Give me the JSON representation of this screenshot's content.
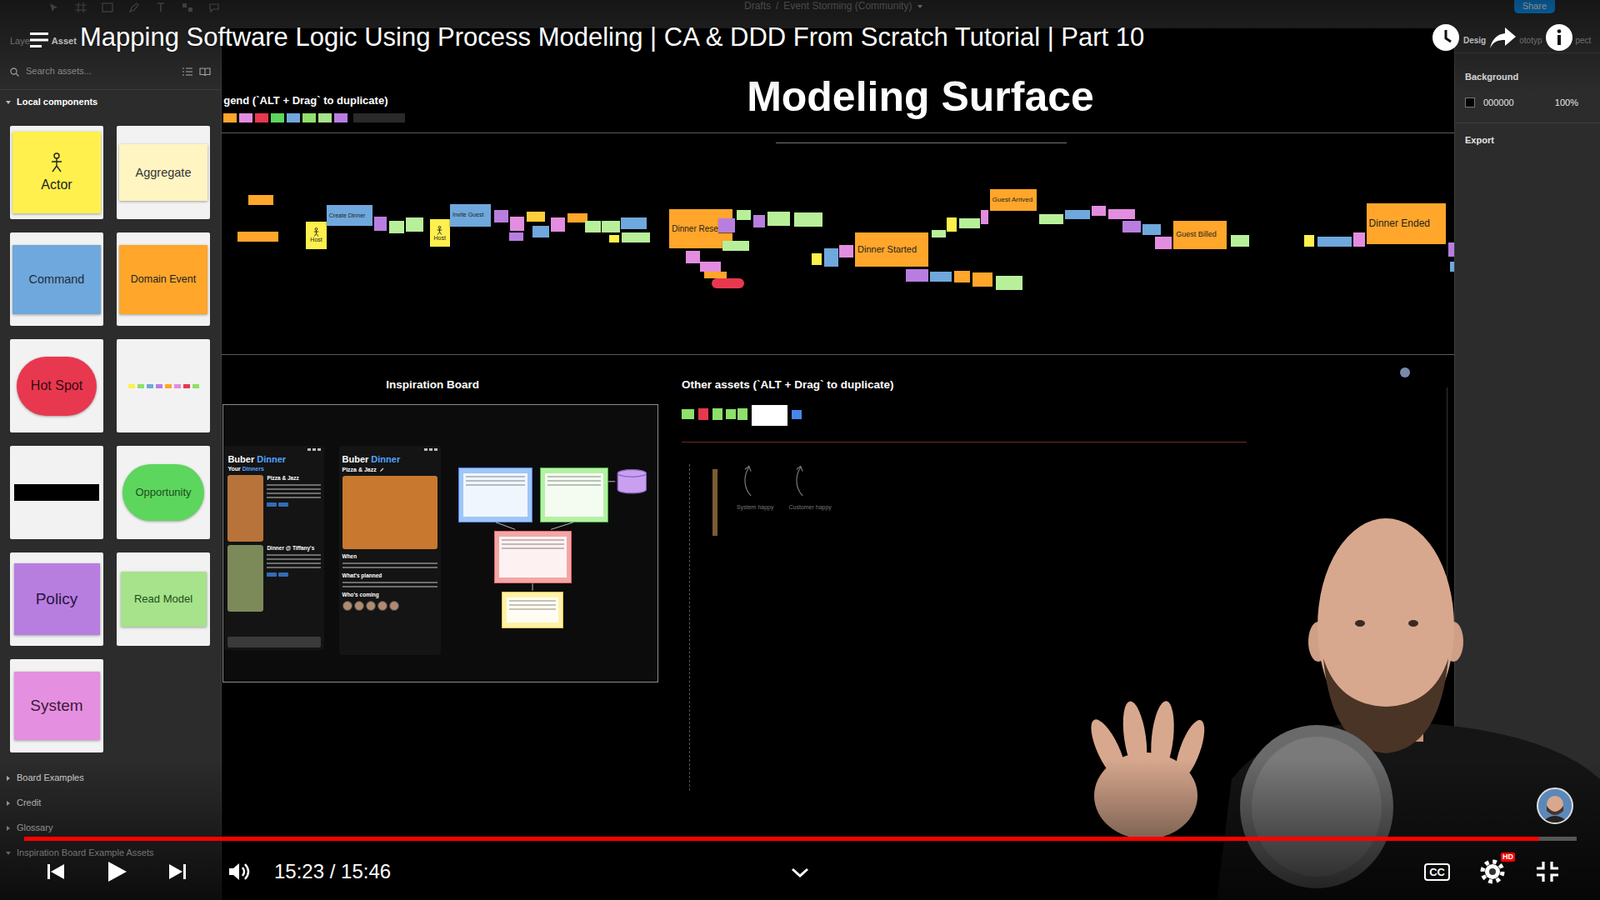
{
  "video": {
    "title": "Mapping Software Logic Using Process Modeling | CA & DDD From Scratch Tutorial | Part 10",
    "time": "15:23 / 15:46",
    "progress": {
      "level": 0.976
    },
    "captions": "CC",
    "quality": "HD"
  },
  "figma": {
    "breadcrumb": {
      "folder": "Drafts",
      "separator": "/",
      "file": "Event Storming (Community)"
    },
    "share": "Share",
    "left_tabs": [
      {
        "label": "Laye",
        "selected": false
      },
      {
        "label": "Asset",
        "selected": true
      }
    ],
    "search": {
      "placeholder": "Search assets..."
    },
    "local_components": {
      "label": "Local components",
      "expanded": true
    },
    "components": [
      {
        "kind": "actor",
        "label": "Actor",
        "color": "#fff04d"
      },
      {
        "kind": "sticky",
        "label": "Aggregate",
        "color": "#fff5c2"
      },
      {
        "kind": "sticky",
        "label": "Command",
        "color": "#6fa8dc"
      },
      {
        "kind": "sticky",
        "label": "Domain Event",
        "color": "#ffa62b"
      },
      {
        "kind": "pill",
        "label": "Hot Spot",
        "color": "#e8384f"
      },
      {
        "kind": "strip",
        "colors": [
          "#fff04d",
          "#8ee06a",
          "#6fa8dc",
          "#b77ee0",
          "#ffa62b",
          "#e38de0",
          "#e8384f",
          "#8ee06a"
        ]
      },
      {
        "kind": "divider",
        "color": "#000000"
      },
      {
        "kind": "pill",
        "label": "Opportunity",
        "color": "#5cd65c"
      },
      {
        "kind": "sticky",
        "label": "Policy",
        "color": "#b77ee0"
      },
      {
        "kind": "sticky",
        "label": "Read Model",
        "color": "#a6e38a"
      },
      {
        "kind": "sticky",
        "label": "System",
        "color": "#e58fe0"
      }
    ],
    "groups": [
      {
        "label": "Board Examples",
        "expanded": false
      },
      {
        "label": "Credit",
        "expanded": false
      },
      {
        "label": "Glossary",
        "expanded": false
      },
      {
        "label": "Inspiration Board Example Assets",
        "expanded": true
      }
    ],
    "right_tabs": [
      {
        "label": "Desig",
        "selected": true
      },
      {
        "label": "ototyp",
        "selected": false
      },
      {
        "label": "pect",
        "selected": false
      }
    ],
    "background": {
      "label": "Background",
      "hex": "000000",
      "opacity": "100%",
      "color": "#000000"
    },
    "export": "Export"
  },
  "canvas": {
    "title": "Modeling Surface",
    "legend": {
      "label": "gend (`ALT + Drag` to duplicate)",
      "chips": [
        "#ffa62b",
        "#e38de0",
        "#e8384f",
        "#5cd65c",
        "#6fa8dc",
        "#8ee06a",
        "#a6e38a",
        "#b77ee0"
      ]
    },
    "events": [
      {
        "kind": "actor",
        "text": "Host",
        "color": "#fff04d"
      },
      {
        "kind": "command",
        "text": "Create Dinner",
        "color": "#6fa8dc"
      },
      {
        "kind": "actor",
        "text": "Host",
        "color": "#fff04d"
      },
      {
        "kind": "command",
        "text": "Invite Guest",
        "color": "#6fa8dc"
      },
      {
        "kind": "event",
        "text": "Dinner Reserve",
        "color": "#ffa62b"
      },
      {
        "kind": "event",
        "text": "Dinner Started",
        "color": "#ffa62b"
      },
      {
        "kind": "event",
        "text": "Guest Arrived",
        "color": "#ffa62b"
      },
      {
        "kind": "event",
        "text": "Guest Billed",
        "color": "#ffa62b"
      },
      {
        "kind": "event",
        "text": "Dinner Ended",
        "color": "#ffa62b"
      }
    ],
    "notes": [
      {
        "color": "#ffa62b"
      },
      {
        "color": "#ffa62b"
      },
      {
        "color": "#b77ee0"
      },
      {
        "color": "#b8f09a"
      },
      {
        "color": "#b8f09a"
      },
      {
        "color": "#b77ee0"
      },
      {
        "color": "#e38de0"
      },
      {
        "color": "#b77ee0"
      },
      {
        "color": "#ffcf3a"
      },
      {
        "color": "#6fa8dc"
      },
      {
        "color": "#e38de0"
      },
      {
        "color": "#ffa62b"
      },
      {
        "color": "#b8f09a"
      },
      {
        "color": "#b8f09a"
      },
      {
        "color": "#fff04d"
      },
      {
        "color": "#6fa8dc"
      },
      {
        "color": "#b8f09a"
      },
      {
        "color": "#e38de0"
      },
      {
        "color": "#e38de0"
      },
      {
        "color": "#ffa62b"
      },
      {
        "color": "#b77ee0"
      },
      {
        "color": "#b8f09a"
      },
      {
        "color": "#b8f09a"
      },
      {
        "color": "#b77ee0"
      },
      {
        "color": "#b8f09a"
      },
      {
        "color": "#b8f09a"
      },
      {
        "color": "#fff04d"
      },
      {
        "color": "#6fa8dc"
      },
      {
        "color": "#e38de0"
      },
      {
        "color": "#b77ee0"
      },
      {
        "color": "#6fa8dc"
      },
      {
        "color": "#ffa62b"
      },
      {
        "color": "#ffa62b"
      },
      {
        "color": "#b8f09a"
      },
      {
        "color": "#b8f09a"
      },
      {
        "color": "#fff04d"
      },
      {
        "color": "#b8f09a"
      },
      {
        "color": "#e38de0"
      },
      {
        "color": "#b8f09a"
      },
      {
        "color": "#6fa8dc"
      },
      {
        "color": "#e38de0"
      },
      {
        "color": "#e38de0"
      },
      {
        "color": "#b77ee0"
      },
      {
        "color": "#6fa8dc"
      },
      {
        "color": "#e38de0"
      },
      {
        "color": "#b8f09a"
      },
      {
        "color": "#fff04d"
      },
      {
        "color": "#6fa8dc"
      },
      {
        "color": "#e38de0"
      },
      {
        "color": "#b77ee0"
      },
      {
        "color": "#6fa8dc"
      }
    ],
    "hotspots": [
      {
        "color": "#e8384f"
      }
    ],
    "inspiration": {
      "title": "Inspiration Board",
      "phones": [
        {
          "kind": "list",
          "brand": "Buber",
          "app": "Dinner",
          "subtitle": [
            "Your",
            "Dinners"
          ],
          "items": [
            "Pizza & Jazz",
            "Dinner @ Tiffany's"
          ]
        },
        {
          "kind": "detail",
          "brand": "Buber",
          "app": "Dinner",
          "heading": "Pizza & Jazz",
          "sections": [
            "When",
            "What's planned",
            "Who's coming"
          ]
        }
      ],
      "layers": [
        {
          "color": "#9fc5f8",
          "border": "#4a86e8"
        },
        {
          "color": "#b6f0a4",
          "border": "#3cb043"
        },
        {
          "color": "#f4a6a6",
          "border": "#e06666"
        },
        {
          "color": "#fff2a8",
          "border": "#d8c04a"
        }
      ],
      "database": {
        "color": "#c9a0f0"
      }
    },
    "other_assets": {
      "title": "Other assets (`ALT + Drag` to duplicate)",
      "chips": [
        "#8ee06a",
        "#e8384f",
        "#8ee06a",
        "#8ee06a",
        "#8ee06a",
        "#ffffff",
        "#4a86e8"
      ],
      "arrows": [
        "System happy",
        "Customer happy"
      ]
    }
  }
}
